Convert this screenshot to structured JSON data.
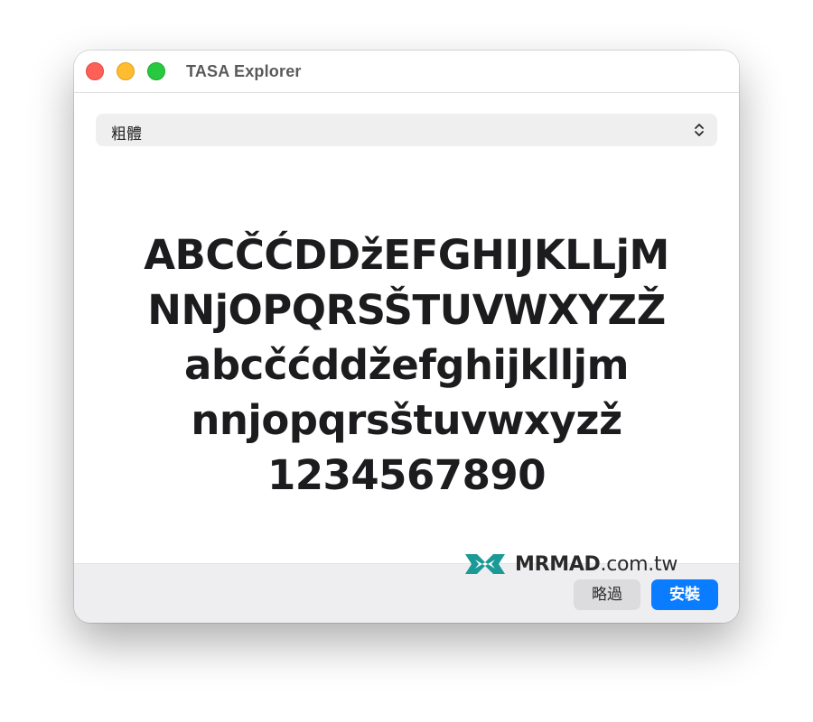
{
  "window": {
    "title": "TASA Explorer"
  },
  "font_selector": {
    "selected": "粗體"
  },
  "preview": {
    "lines": [
      "ABCČĆDDžEFGHIJKLLjM",
      "NNjOPQRSŠTUVWXYZŽ",
      "abcčćddžefghijklljm",
      "nnjopqrsštuvwxyzž",
      "1234567890"
    ]
  },
  "footer": {
    "skip_label": "略過",
    "install_label": "安裝"
  },
  "watermark": {
    "brand": "MRMAD",
    "domain": ".com.tw"
  },
  "colors": {
    "accent": "#0a7cff",
    "watermark_logo": "#1a9a96"
  }
}
